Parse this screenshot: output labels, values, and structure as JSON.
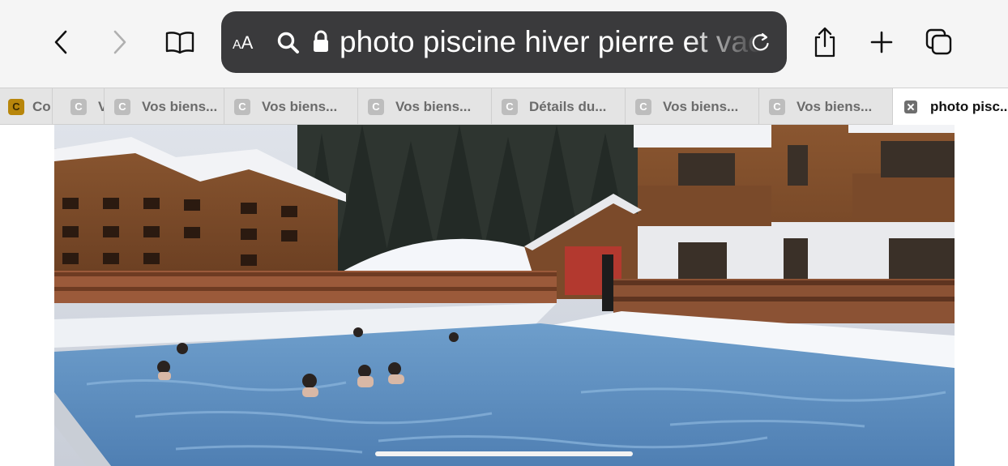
{
  "toolbar": {
    "back_icon": "chevron-left-icon",
    "forward_icon": "chevron-right-icon",
    "bookmarks_icon": "book-icon",
    "share_icon": "share-icon",
    "new_tab_icon": "plus-icon",
    "tabs_overview_icon": "tabs-icon"
  },
  "address_bar": {
    "text_size_label_small": "A",
    "text_size_label_large": "A",
    "url_text": "photo piscine hiver pierre et vacances",
    "search_icon": "search-icon",
    "lock_icon": "lock-icon",
    "reload_icon": "reload-icon"
  },
  "tabs": [
    {
      "favicon": "C",
      "title": "Co"
    },
    {
      "favicon": "C",
      "title": "V"
    },
    {
      "favicon": "C",
      "title": "Vos biens..."
    },
    {
      "favicon": "C",
      "title": "Vos biens..."
    },
    {
      "favicon": "C",
      "title": "Vos biens..."
    },
    {
      "favicon": "C",
      "title": "Détails du..."
    },
    {
      "favicon": "C",
      "title": "Vos biens..."
    },
    {
      "favicon": "C",
      "title": "Vos biens..."
    },
    {
      "favicon": "close-icon",
      "title": "photo pisc..."
    }
  ],
  "content": {
    "image_subject": "outdoor-heated-pool-snow-chalets"
  },
  "colors": {
    "address_bar_bg": "#3a3a3c",
    "toolbar_bg": "#f5f5f5",
    "tabstrip_bg": "#e4e4e4"
  }
}
